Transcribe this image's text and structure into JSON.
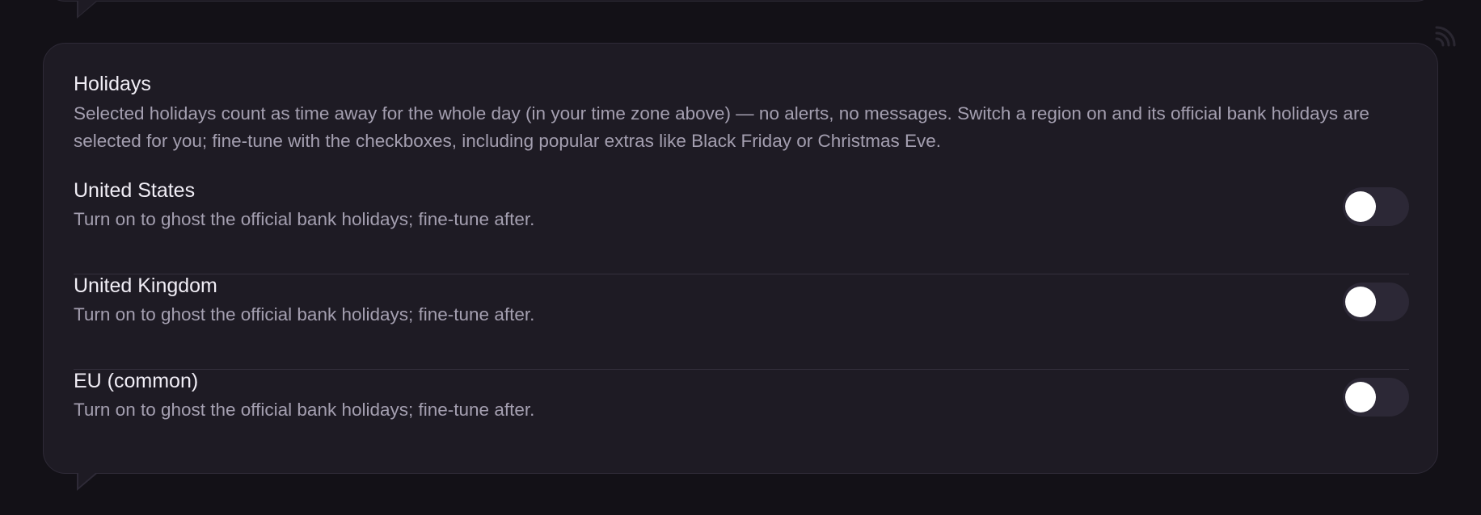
{
  "holidays": {
    "title": "Holidays",
    "description": "Selected holidays count as time away for the whole day (in your time zone above) — no alerts, no messages. Switch a region on and its official bank holidays are selected for you; fine-tune with the checkboxes, including popular extras like Black Friday or Christmas Eve.",
    "regions": [
      {
        "name": "United States",
        "hint": "Turn on to ghost the official bank holidays; fine-tune after.",
        "enabled": false
      },
      {
        "name": "United Kingdom",
        "hint": "Turn on to ghost the official bank holidays; fine-tune after.",
        "enabled": false
      },
      {
        "name": "EU (common)",
        "hint": "Turn on to ghost the official bank holidays; fine-tune after.",
        "enabled": false
      }
    ]
  },
  "icons": {
    "corner": "rss-icon"
  },
  "colors": {
    "background": "#131117",
    "card": "#1e1b24",
    "text_primary": "#f1eef6",
    "text_secondary": "#a49fb0",
    "toggle_off": "#2c2836"
  }
}
